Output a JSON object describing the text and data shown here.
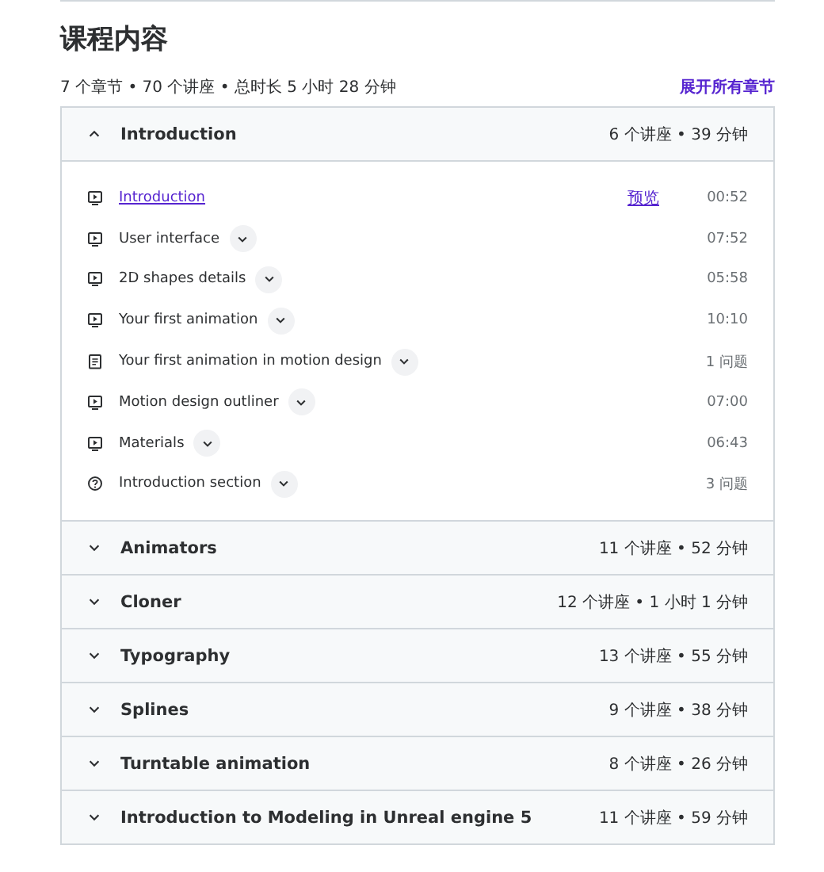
{
  "title": "课程内容",
  "summary": "7 个章节 • 70 个讲座 • 总时长 5 小时 28 分钟",
  "expand_all": "展开所有章节",
  "sections": [
    {
      "title": "Introduction",
      "summary": "6 个讲座 • 39 分钟",
      "expanded": true,
      "lectures": [
        {
          "kind": "video",
          "title": "Introduction",
          "preview": "预览",
          "duration": "00:52"
        },
        {
          "kind": "video",
          "title": "User interface",
          "duration": "07:52"
        },
        {
          "kind": "video",
          "title": "2D shapes details",
          "duration": "05:58"
        },
        {
          "kind": "video",
          "title": "Your first animation",
          "duration": "10:10"
        },
        {
          "kind": "assignment",
          "title": "Your first animation in motion design",
          "duration": "1 问题"
        },
        {
          "kind": "video",
          "title": "Motion design outliner",
          "duration": "07:00"
        },
        {
          "kind": "video",
          "title": "Materials",
          "duration": "06:43"
        },
        {
          "kind": "quiz",
          "title": "Introduction section",
          "duration": "3 问题"
        }
      ]
    },
    {
      "title": "Animators",
      "summary": "11 个讲座 • 52 分钟",
      "expanded": false
    },
    {
      "title": "Cloner",
      "summary": "12 个讲座 • 1 小时 1 分钟",
      "expanded": false
    },
    {
      "title": "Typography",
      "summary": "13 个讲座 • 55 分钟",
      "expanded": false
    },
    {
      "title": "Splines",
      "summary": "9 个讲座 • 38 分钟",
      "expanded": false
    },
    {
      "title": "Turntable animation",
      "summary": "8 个讲座 • 26 分钟",
      "expanded": false
    },
    {
      "title": "Introduction to Modeling in Unreal engine 5",
      "summary": "11 个讲座 • 59 分钟",
      "expanded": false
    }
  ]
}
